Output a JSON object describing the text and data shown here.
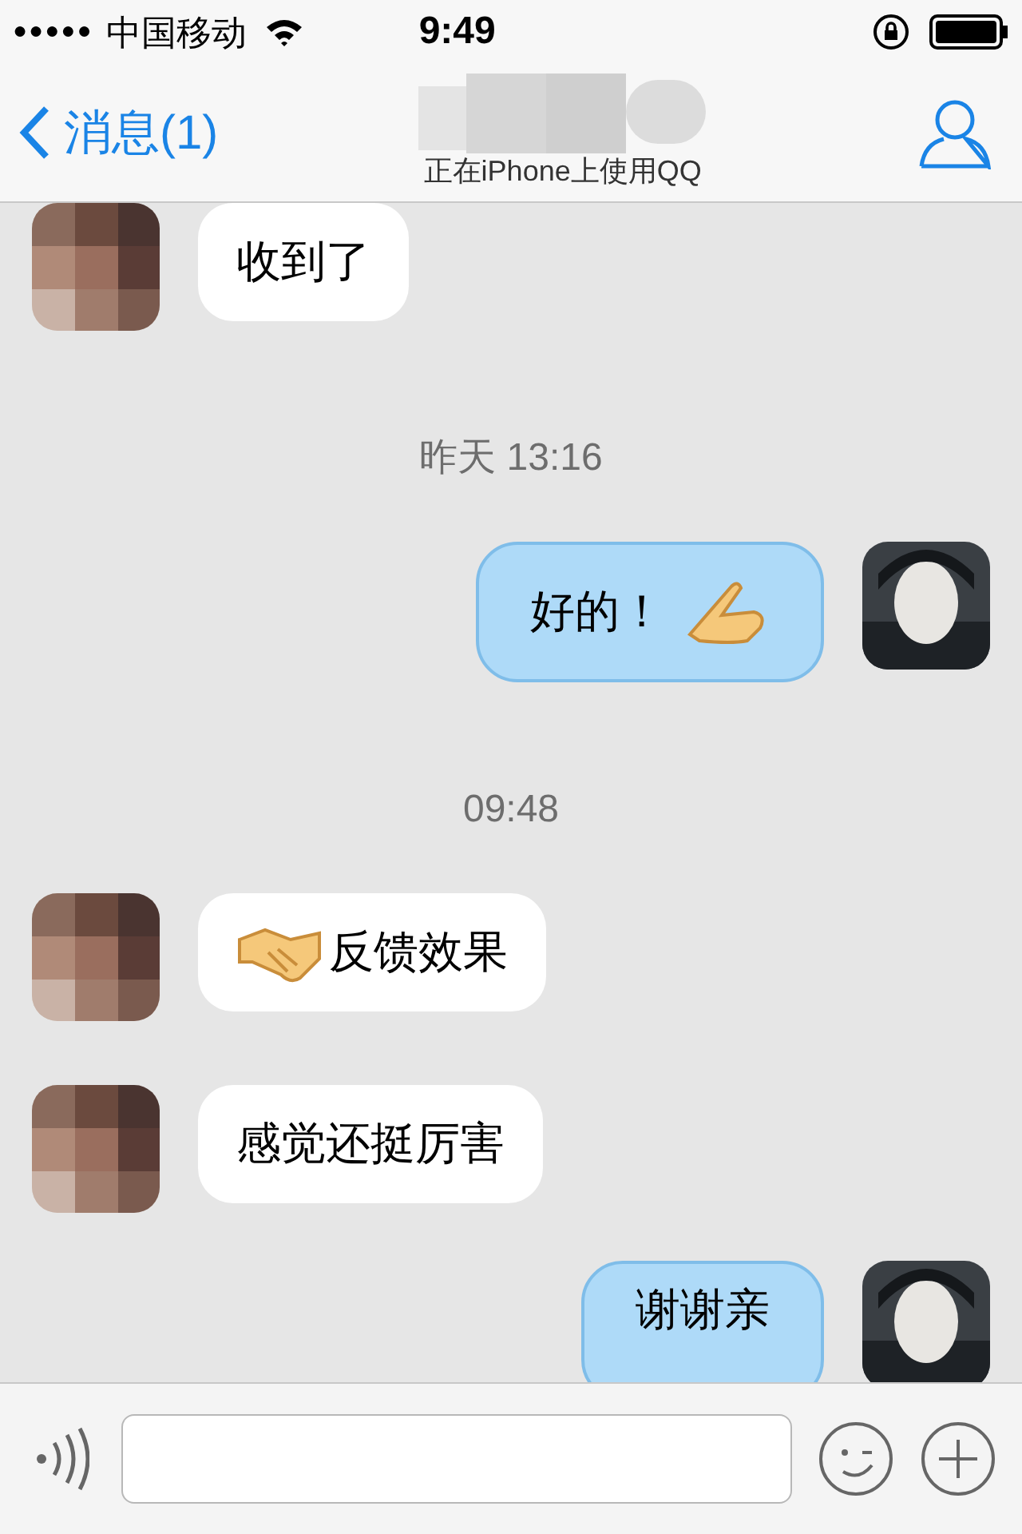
{
  "status_bar": {
    "signal": "●●●●●",
    "carrier": "中国移动",
    "time": "9:49"
  },
  "nav": {
    "back_label": "消息(1)",
    "subtitle": "正在iPhone上使用QQ"
  },
  "messages": [
    {
      "kind": "incoming",
      "parts": [
        {
          "kind": "text",
          "text": "收到了"
        }
      ]
    },
    {
      "kind": "timestamp",
      "text": "昨天 13:16"
    },
    {
      "kind": "outgoing",
      "parts": [
        {
          "kind": "text",
          "text": "好的！"
        },
        {
          "kind": "hand-emoji"
        }
      ]
    },
    {
      "kind": "timestamp",
      "text": "09:48"
    },
    {
      "kind": "incoming",
      "parts": [
        {
          "kind": "handshake-emoji"
        },
        {
          "kind": "text",
          "text": "反馈效果"
        }
      ]
    },
    {
      "kind": "incoming",
      "parts": [
        {
          "kind": "text",
          "text": "感觉还挺厉害"
        }
      ]
    },
    {
      "kind": "outgoing",
      "parts": [
        {
          "kind": "text",
          "text": "谢谢亲"
        }
      ]
    }
  ]
}
